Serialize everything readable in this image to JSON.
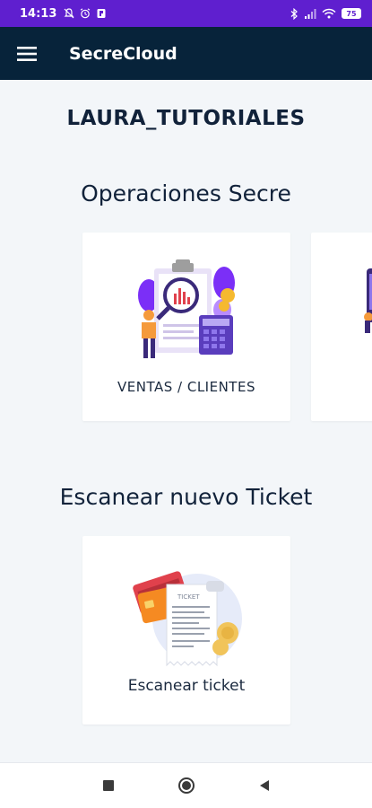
{
  "status_bar": {
    "time": "14:13",
    "battery": "75",
    "icons_left": [
      "mute-icon",
      "alarm-icon",
      "app-notification-icon"
    ],
    "icons_right": [
      "bluetooth-icon",
      "signal-icon",
      "wifi-icon",
      "battery-icon"
    ]
  },
  "app_bar": {
    "title": "SecreCloud",
    "menu_icon": "hamburger-menu-icon"
  },
  "user": {
    "name": "LAURA_TUTORIALES"
  },
  "operations": {
    "title": "Operaciones Secre",
    "cards": [
      {
        "label": "VENTAS / CLIENTES",
        "icon": "sales-clients-illustration"
      },
      {
        "label": "",
        "icon": "partial-illustration"
      }
    ]
  },
  "scan": {
    "title": "Escanear nuevo Ticket",
    "cards": [
      {
        "label": "Escanear ticket",
        "icon": "ticket-scan-illustration",
        "ticket_text": "TICKET"
      }
    ]
  },
  "nav_bar": {
    "buttons": [
      "recents-button",
      "home-button",
      "back-button"
    ]
  },
  "colors": {
    "status_bar": "#5f1fcf",
    "app_bar": "#07233a",
    "background": "#f3f6f9",
    "text_dark": "#11223a"
  }
}
